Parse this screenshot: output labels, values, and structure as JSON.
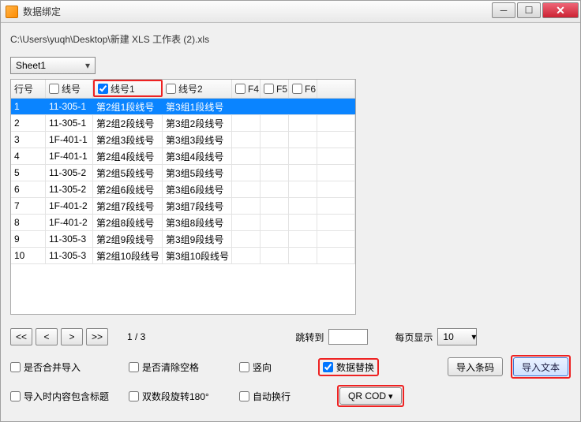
{
  "window": {
    "title": "数据绑定"
  },
  "file_path": "C:\\Users\\yuqh\\Desktop\\新建 XLS 工作表 (2).xls",
  "sheet_selected": "Sheet1",
  "columns": {
    "c0": {
      "label": "行号",
      "checkable": false
    },
    "c1": {
      "label": "线号",
      "checked": false
    },
    "c2": {
      "label": "线号1",
      "checked": true,
      "highlighted": true
    },
    "c3": {
      "label": "线号2",
      "checked": false
    },
    "c4": {
      "label": "F4",
      "checked": false
    },
    "c5": {
      "label": "F5",
      "checked": false
    },
    "c6": {
      "label": "F6",
      "checked": false
    }
  },
  "rows": [
    {
      "n": "1",
      "a": "11-305-1",
      "b": "第2组1段线号",
      "c": "第3组1段线号",
      "sel": true
    },
    {
      "n": "2",
      "a": "11-305-1",
      "b": "第2组2段线号",
      "c": "第3组2段线号"
    },
    {
      "n": "3",
      "a": "1F-401-1",
      "b": "第2组3段线号",
      "c": "第3组3段线号"
    },
    {
      "n": "4",
      "a": "1F-401-1",
      "b": "第2组4段线号",
      "c": "第3组4段线号"
    },
    {
      "n": "5",
      "a": "11-305-2",
      "b": "第2组5段线号",
      "c": "第3组5段线号"
    },
    {
      "n": "6",
      "a": "11-305-2",
      "b": "第2组6段线号",
      "c": "第3组6段线号"
    },
    {
      "n": "7",
      "a": "1F-401-2",
      "b": "第2组7段线号",
      "c": "第3组7段线号"
    },
    {
      "n": "8",
      "a": "1F-401-2",
      "b": "第2组8段线号",
      "c": "第3组8段线号"
    },
    {
      "n": "9",
      "a": "11-305-3",
      "b": "第2组9段线号",
      "c": "第3组9段线号"
    },
    {
      "n": "10",
      "a": "11-305-3",
      "b": "第2组10段线号",
      "c": "第3组10段线号"
    }
  ],
  "pager": {
    "first": "<<",
    "prev": "<",
    "next": ">",
    "last": ">>",
    "info": "1 / 3",
    "jump_label": "跳转到",
    "jump_value": "",
    "perpage_label": "每页显示",
    "perpage_value": "10"
  },
  "options": {
    "merge_import": "是否合并导入",
    "clear_spaces": "是否清除空格",
    "vertical": "竖向",
    "data_replace": "数据替换",
    "import_has_title": "导入时内容包含标题",
    "double_rotate": "双数段旋转180°",
    "auto_wrap": "自动换行"
  },
  "buttons": {
    "qrcod": "QR COD",
    "import_barcode": "导入条码",
    "import_text": "导入文本"
  }
}
